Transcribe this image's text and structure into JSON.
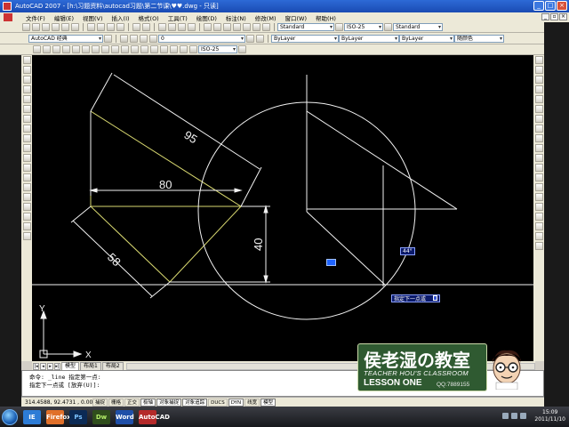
{
  "window": {
    "title": "AutoCAD 2007 - [h:\\习题资料\\autocad习题\\第二节课\\♥♥.dwg - 只读]",
    "minimize": "_",
    "maximize": "□",
    "close": "×"
  },
  "menu": {
    "items": [
      "文件(F)",
      "编辑(E)",
      "视图(V)",
      "插入(I)",
      "格式(O)",
      "工具(T)",
      "绘图(D)",
      "标注(N)",
      "修改(M)",
      "窗口(W)",
      "帮助(H)"
    ]
  },
  "toolbar": {
    "workspace": "AutoCAD 经典",
    "layer": "0",
    "text_style": "Standard",
    "dim_style": "ISO-25",
    "table_style": "Standard",
    "color": "ByLayer",
    "linetype": "ByLayer",
    "lineweight": "ByLayer",
    "plot_style": "随颜色",
    "dim_style_2": "ISO-25"
  },
  "drawing": {
    "dim_95": "95",
    "dim_80": "80",
    "dim_58": "58",
    "dim_40": "40",
    "angle_tooltip": "44°",
    "prompt_tooltip": "指定下一点或",
    "ucs_x": "X",
    "ucs_y": "Y",
    "colors": {
      "yellow": "#d8d870",
      "white": "#f2f2f2",
      "background": "#000000"
    }
  },
  "tabs": [
    "模型",
    "布局1",
    "布局2"
  ],
  "command": {
    "line1": "命令: _line 指定第一点:",
    "line2": "指定下一点或 [放弃(U)]:"
  },
  "status": {
    "coords": "314.4588, 92.4731 , 0.0000",
    "buttons": [
      "捕捉",
      "栅格",
      "正交",
      "极轴",
      "对象捕捉",
      "对象追踪",
      "DUCS",
      "DYN",
      "线宽",
      "模型"
    ],
    "active": [
      "极轴",
      "对象捕捉",
      "对象追踪",
      "DYN",
      "模型"
    ]
  },
  "taskbar": {
    "apps": [
      "IE",
      "Firefox",
      "Ps",
      "Dw",
      "Word",
      "AutoCAD"
    ],
    "time": "15:09",
    "date": "2011/11/10"
  },
  "logo": {
    "title": "侯老湿の教室",
    "subtitle": "TEACHER HOU'S CLASSROOM",
    "lesson": "LESSON ONE",
    "qq": "QQ:7889155"
  }
}
